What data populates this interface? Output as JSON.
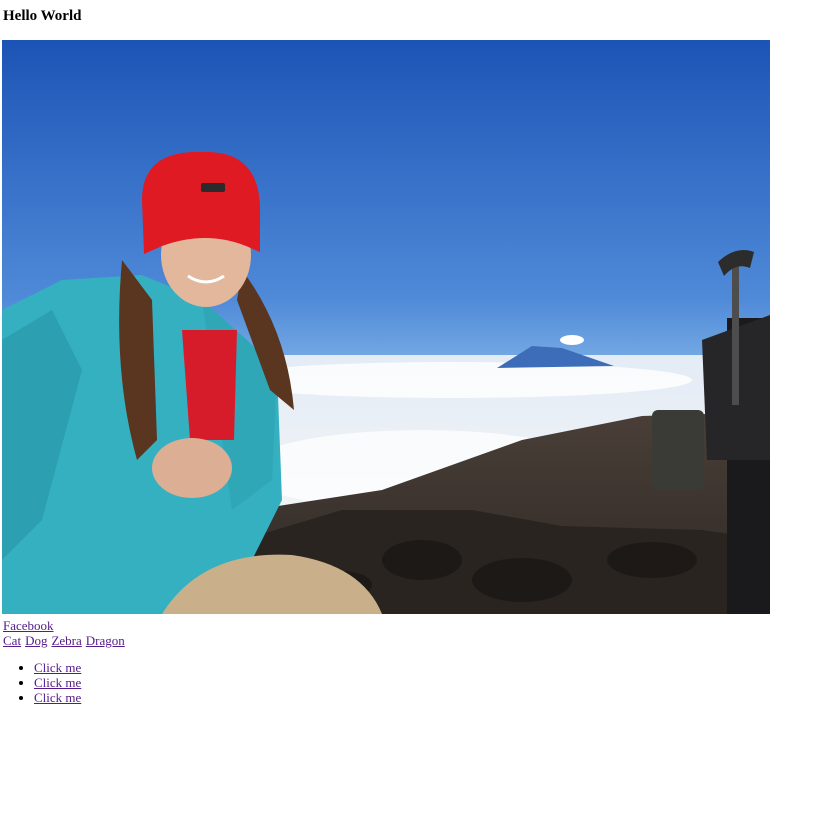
{
  "page": {
    "heading": "Hello World"
  },
  "photo": {
    "alt": "Hiker in red beanie and teal fleece on a rocky summit above the clouds",
    "colors": {
      "sky_top": "#1d56b8",
      "sky_bottom": "#7fb3e8",
      "clouds": "#f2f4f7",
      "hat": "#e5161f",
      "fleece": "#3db6c4",
      "rocks": "#3a332e"
    }
  },
  "links": {
    "facebook": "Facebook",
    "animals": [
      "Cat",
      "Dog",
      "Zebra",
      "Dragon"
    ]
  },
  "list": {
    "items": [
      "Click me",
      "Click me",
      "Click me"
    ]
  }
}
